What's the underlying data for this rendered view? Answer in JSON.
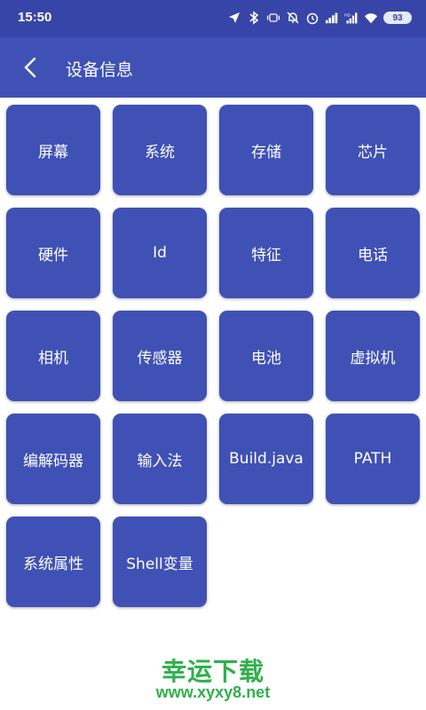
{
  "status_bar": {
    "time": "15:50",
    "battery": "93",
    "icons": [
      "location-icon",
      "bluetooth-icon",
      "vibrate-icon",
      "mute-icon",
      "alarm-icon",
      "signal-icon",
      "hd-signal-icon",
      "wifi-icon",
      "battery-icon"
    ]
  },
  "app_bar": {
    "back_icon": "chevron-left-icon",
    "title": "设备信息"
  },
  "tiles": [
    {
      "label": "屏幕"
    },
    {
      "label": "系统"
    },
    {
      "label": "存储"
    },
    {
      "label": "芯片"
    },
    {
      "label": "硬件"
    },
    {
      "label": "Id"
    },
    {
      "label": "特征"
    },
    {
      "label": "电话"
    },
    {
      "label": "相机"
    },
    {
      "label": "传感器"
    },
    {
      "label": "电池"
    },
    {
      "label": "虚拟机"
    },
    {
      "label": "编解码器"
    },
    {
      "label": "输入法"
    },
    {
      "label": "Build.java"
    },
    {
      "label": "PATH"
    },
    {
      "label": "系统属性"
    },
    {
      "label": "Shell变量"
    }
  ],
  "watermark": {
    "title": "幸运下载",
    "url": "www.xyxy8.net"
  },
  "colors": {
    "status_bar": "#3745a8",
    "primary": "#3f51b5",
    "watermark": "#2fb04a"
  }
}
